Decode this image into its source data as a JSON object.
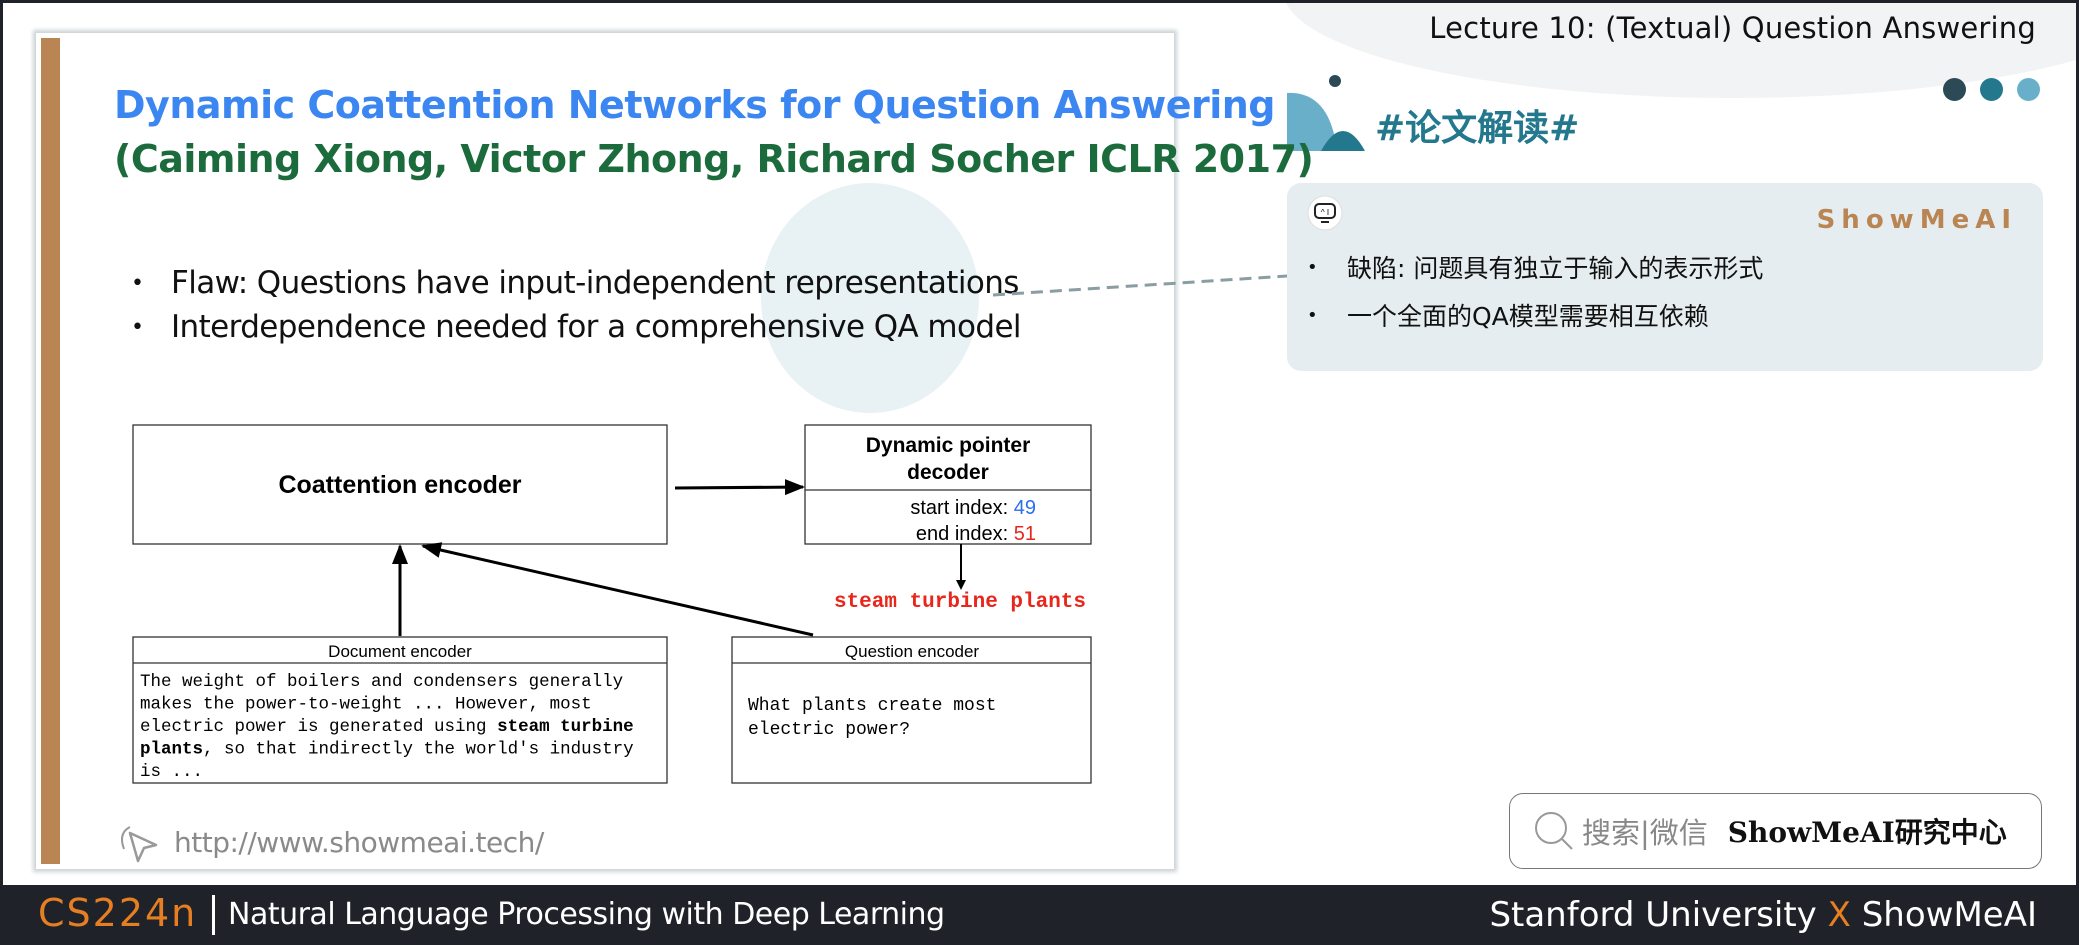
{
  "header": {
    "lecture_title": "Lecture 10:  (Textual) Question Answering",
    "section_tag": "#论文解读#",
    "dot_colors": [
      "#2b4a55",
      "#23788e",
      "#6aafc9"
    ]
  },
  "slide": {
    "title_line1": "Dynamic Coattention Networks for Question Answering",
    "title_line2": "(Caiming Xiong, Victor Zhong, Richard Socher ICLR 2017)",
    "title_colors": {
      "line1": "#3b86f0",
      "line2": "#1b6b3c"
    },
    "bullets": [
      "Flaw: Questions have input-independent representations",
      "Interdependence needed for a comprehensive QA model"
    ],
    "bullet_symbol": "•",
    "accent_bar_color": "#b98553",
    "url": "http://www.showmeai.tech/",
    "diagram": {
      "coattention_encoder": "Coattention encoder",
      "decoder_title_line1": "Dynamic pointer",
      "decoder_title_line2": "decoder",
      "start_index_label": "start index: ",
      "start_index_value": "49",
      "end_index_label": "end index: ",
      "end_index_value": "51",
      "answer": "steam turbine plants",
      "document_encoder_title": "Document encoder",
      "document_text": [
        [
          {
            "t": "The weight of boilers and condensers generally",
            "b": false
          }
        ],
        [
          {
            "t": "makes the power-to-weight ... However, most",
            "b": false
          }
        ],
        [
          {
            "t": "electric power is generated using ",
            "b": false
          },
          {
            "t": "steam turbine",
            "b": true
          }
        ],
        [
          {
            "t": "plants",
            "b": true
          },
          {
            "t": ", so that indirectly the world's industry",
            "b": false
          }
        ],
        [
          {
            "t": "is  ...",
            "b": false
          }
        ]
      ],
      "question_encoder_title": "Question encoder",
      "question_text": [
        "What plants create most",
        "electric power?"
      ],
      "colors": {
        "start": "#2a6ef2",
        "end": "#e8261c",
        "answer": "#e8261c"
      }
    }
  },
  "note_card": {
    "brand": "ShowMeAI",
    "items": [
      "缺陷: 问题具有独立于输入的表示形式",
      "一个全面的QA模型需要相互依赖"
    ]
  },
  "search": {
    "hint": "搜索|微信",
    "brand": "ShowMeAI研究中心"
  },
  "footer": {
    "course_code": "CS224n",
    "course_name": "Natural Language Processing with Deep Learning",
    "credits_left": "Stanford University ",
    "credits_x": "X",
    "credits_right": " ShowMeAI"
  }
}
